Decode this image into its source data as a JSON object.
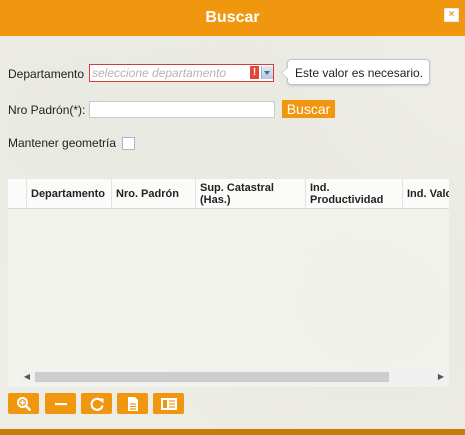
{
  "dialog": {
    "title": "Buscar",
    "close_label": "×"
  },
  "form": {
    "departamento_label": "Departamento",
    "departamento_placeholder": "seleccione departamento",
    "error_mark": "!",
    "validation_tooltip": "Este valor es necesario.",
    "padron_label": "Nro Padrón(*):",
    "padron_value": "",
    "buscar_button": "Buscar",
    "mantener_label": "Mantener geometría",
    "mantener_checked": false
  },
  "grid": {
    "columns": [
      "Departamento",
      "Nro. Padrón",
      "Sup. Catastral (Has.)",
      "Ind. Productividad",
      "Ind. Valor"
    ],
    "rows": []
  },
  "toolbar": {
    "buttons": [
      "zoom-in-icon",
      "minus-icon",
      "refresh-icon",
      "document-icon",
      "panel-icon"
    ]
  },
  "colors": {
    "accent": "#f0960f",
    "error": "#e0463b"
  }
}
